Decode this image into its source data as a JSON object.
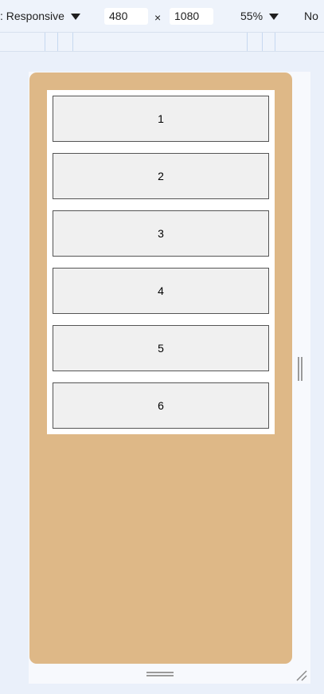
{
  "toolbar": {
    "device_label": ": Responsive",
    "width_value": "480",
    "height_value": "1080",
    "times_symbol": "×",
    "zoom_label": "55%",
    "throttle_label": "No"
  },
  "page": {
    "background_color": "#deb887",
    "items": [
      "1",
      "2",
      "3",
      "4",
      "5",
      "6"
    ]
  }
}
